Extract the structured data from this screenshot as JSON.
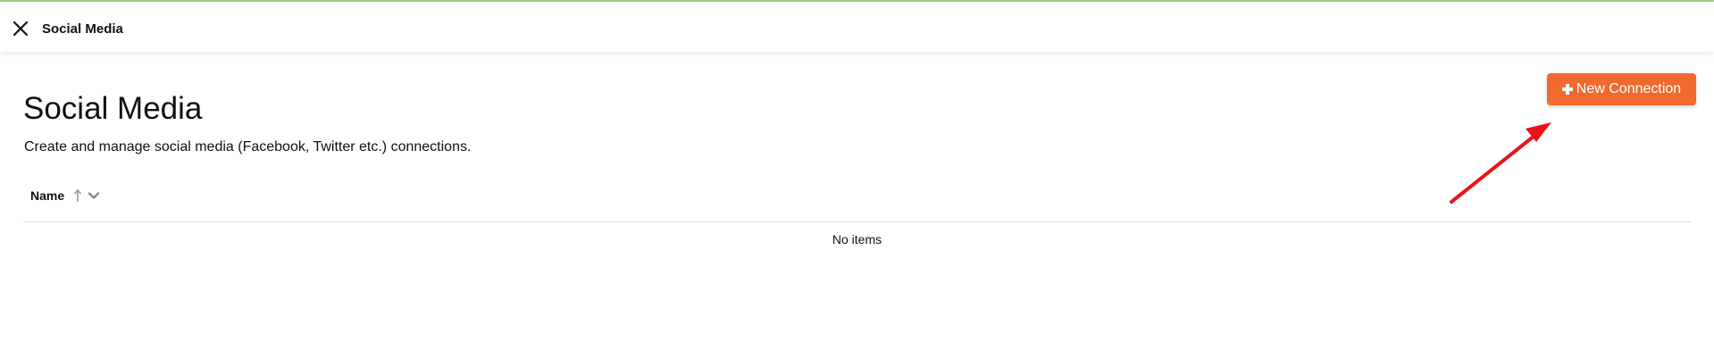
{
  "header": {
    "title": "Social Media",
    "close_icon": "close-icon"
  },
  "main": {
    "title": "Social Media",
    "description": "Create and manage social media (Facebook, Twitter etc.) connections.",
    "new_button": {
      "label": "New Connection",
      "icon": "plus-icon",
      "color": "#f06a2e"
    },
    "table": {
      "columns": [
        {
          "label": "Name",
          "sort_icon": "sort-ascending-icon",
          "menu_icon": "chevron-down-icon"
        }
      ],
      "empty_text": "No items"
    }
  },
  "colors": {
    "accent_bar": "#9ccf8e",
    "annotation_arrow": "#e8141b"
  }
}
